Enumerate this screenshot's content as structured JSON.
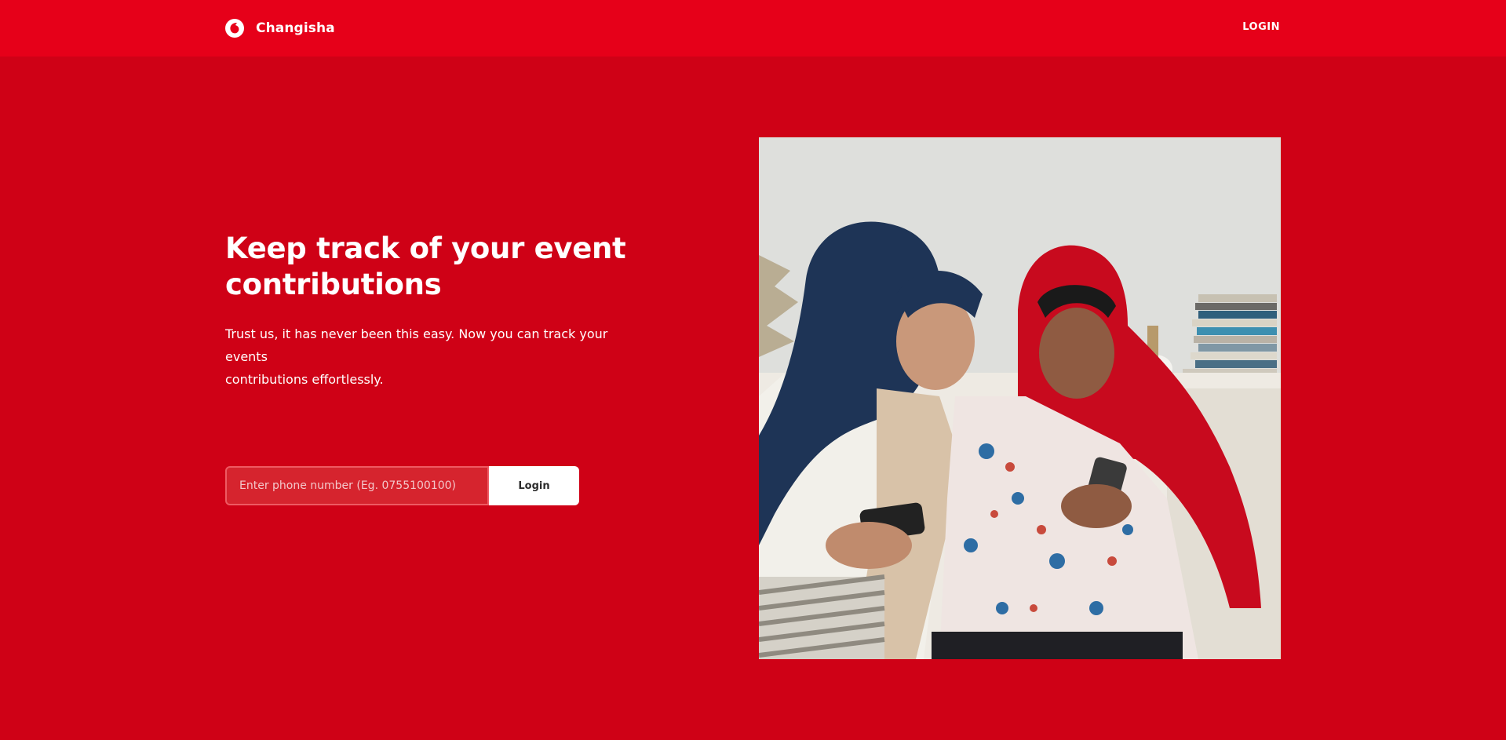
{
  "header": {
    "brand_name": "Changisha",
    "brand_logo_icon": "vodafone-speechmark-icon",
    "login_link": "LOGIN"
  },
  "hero": {
    "headline_line1": "Keep track of your event",
    "headline_line2": "contributions",
    "subtext_line1": "Trust us, it has never been this easy. Now you can track your events",
    "subtext_line2": "contributions effortlessly."
  },
  "login_form": {
    "phone_placeholder": "Enter phone number (Eg. 0755100100)",
    "login_button": "Login"
  },
  "colors": {
    "header_red": "#E60019",
    "hero_red": "#CF0116",
    "input_fill": "#D6242E",
    "button_white": "#FFFFFF"
  }
}
